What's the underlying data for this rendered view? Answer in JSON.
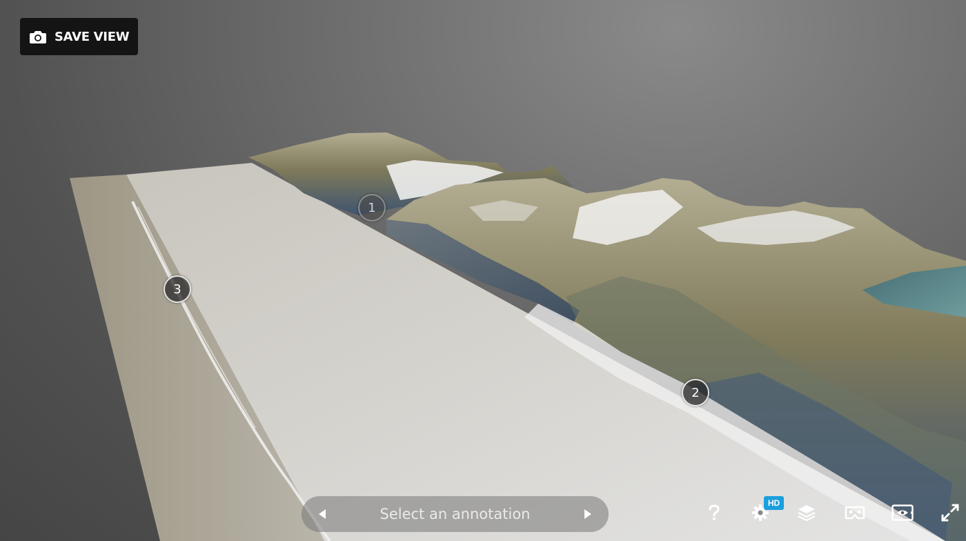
{
  "toolbar_top": {
    "save_view_label": "SAVE VIEW",
    "save_view_icon": "camera-icon"
  },
  "annotations": {
    "hotspots": [
      {
        "label": "1"
      },
      {
        "label": "2"
      },
      {
        "label": "3"
      }
    ],
    "navigator": {
      "placeholder": "Select an annotation",
      "prev_icon": "arrow-left-icon",
      "next_icon": "arrow-right-icon"
    }
  },
  "toolbar_bottom": {
    "help_icon": "help-icon",
    "settings_icon": "gear-icon",
    "settings_badge": "HD",
    "layers_icon": "layers-icon",
    "vr_icon": "vr-headset-icon",
    "ar_icon": "view-in-ar-icon",
    "fullscreen_icon": "fullscreen-icon"
  },
  "colors": {
    "hd_badge": "#1a9fdd",
    "save_button_bg": "#141414"
  }
}
